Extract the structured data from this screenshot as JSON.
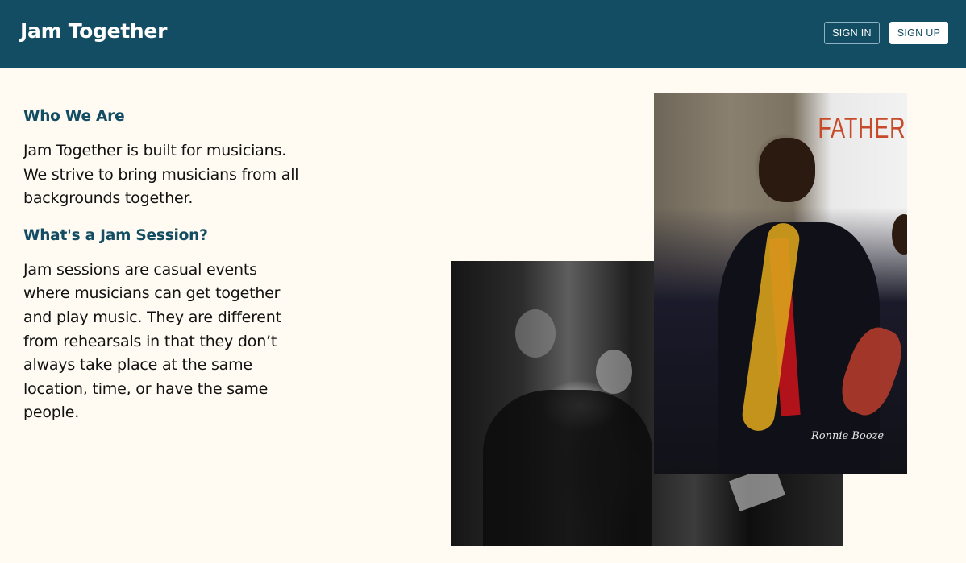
{
  "header": {
    "brand": "Jam Together",
    "sign_in_label": "SIGN IN",
    "sign_up_label": "SIGN UP"
  },
  "main": {
    "who_heading": "Who We Are",
    "who_text": "Jam Together is built for musicians. We strive to bring musicians from all backgrounds together.",
    "jam_heading": "What's a Jam Session?",
    "jam_text": "Jam sessions are casual events where musicians can get together and play music. They are different from rehearsals in that they don’t always take place at the same location, time, or have the same people."
  },
  "photos": {
    "poster_text": "FATHER",
    "watermark": "Ronnie Booze"
  },
  "colors": {
    "header_bg": "#134d63",
    "page_bg": "#fffaf2",
    "heading": "#134d63"
  }
}
